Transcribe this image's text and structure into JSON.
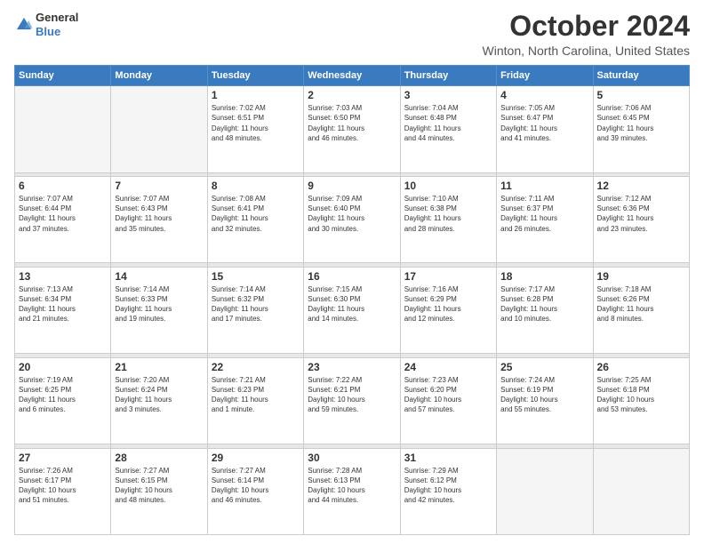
{
  "header": {
    "logo_general": "General",
    "logo_blue": "Blue",
    "title": "October 2024",
    "location": "Winton, North Carolina, United States"
  },
  "weekdays": [
    "Sunday",
    "Monday",
    "Tuesday",
    "Wednesday",
    "Thursday",
    "Friday",
    "Saturday"
  ],
  "weeks": [
    [
      {
        "num": "",
        "lines": []
      },
      {
        "num": "",
        "lines": []
      },
      {
        "num": "1",
        "lines": [
          "Sunrise: 7:02 AM",
          "Sunset: 6:51 PM",
          "Daylight: 11 hours",
          "and 48 minutes."
        ]
      },
      {
        "num": "2",
        "lines": [
          "Sunrise: 7:03 AM",
          "Sunset: 6:50 PM",
          "Daylight: 11 hours",
          "and 46 minutes."
        ]
      },
      {
        "num": "3",
        "lines": [
          "Sunrise: 7:04 AM",
          "Sunset: 6:48 PM",
          "Daylight: 11 hours",
          "and 44 minutes."
        ]
      },
      {
        "num": "4",
        "lines": [
          "Sunrise: 7:05 AM",
          "Sunset: 6:47 PM",
          "Daylight: 11 hours",
          "and 41 minutes."
        ]
      },
      {
        "num": "5",
        "lines": [
          "Sunrise: 7:06 AM",
          "Sunset: 6:45 PM",
          "Daylight: 11 hours",
          "and 39 minutes."
        ]
      }
    ],
    [
      {
        "num": "6",
        "lines": [
          "Sunrise: 7:07 AM",
          "Sunset: 6:44 PM",
          "Daylight: 11 hours",
          "and 37 minutes."
        ]
      },
      {
        "num": "7",
        "lines": [
          "Sunrise: 7:07 AM",
          "Sunset: 6:43 PM",
          "Daylight: 11 hours",
          "and 35 minutes."
        ]
      },
      {
        "num": "8",
        "lines": [
          "Sunrise: 7:08 AM",
          "Sunset: 6:41 PM",
          "Daylight: 11 hours",
          "and 32 minutes."
        ]
      },
      {
        "num": "9",
        "lines": [
          "Sunrise: 7:09 AM",
          "Sunset: 6:40 PM",
          "Daylight: 11 hours",
          "and 30 minutes."
        ]
      },
      {
        "num": "10",
        "lines": [
          "Sunrise: 7:10 AM",
          "Sunset: 6:38 PM",
          "Daylight: 11 hours",
          "and 28 minutes."
        ]
      },
      {
        "num": "11",
        "lines": [
          "Sunrise: 7:11 AM",
          "Sunset: 6:37 PM",
          "Daylight: 11 hours",
          "and 26 minutes."
        ]
      },
      {
        "num": "12",
        "lines": [
          "Sunrise: 7:12 AM",
          "Sunset: 6:36 PM",
          "Daylight: 11 hours",
          "and 23 minutes."
        ]
      }
    ],
    [
      {
        "num": "13",
        "lines": [
          "Sunrise: 7:13 AM",
          "Sunset: 6:34 PM",
          "Daylight: 11 hours",
          "and 21 minutes."
        ]
      },
      {
        "num": "14",
        "lines": [
          "Sunrise: 7:14 AM",
          "Sunset: 6:33 PM",
          "Daylight: 11 hours",
          "and 19 minutes."
        ]
      },
      {
        "num": "15",
        "lines": [
          "Sunrise: 7:14 AM",
          "Sunset: 6:32 PM",
          "Daylight: 11 hours",
          "and 17 minutes."
        ]
      },
      {
        "num": "16",
        "lines": [
          "Sunrise: 7:15 AM",
          "Sunset: 6:30 PM",
          "Daylight: 11 hours",
          "and 14 minutes."
        ]
      },
      {
        "num": "17",
        "lines": [
          "Sunrise: 7:16 AM",
          "Sunset: 6:29 PM",
          "Daylight: 11 hours",
          "and 12 minutes."
        ]
      },
      {
        "num": "18",
        "lines": [
          "Sunrise: 7:17 AM",
          "Sunset: 6:28 PM",
          "Daylight: 11 hours",
          "and 10 minutes."
        ]
      },
      {
        "num": "19",
        "lines": [
          "Sunrise: 7:18 AM",
          "Sunset: 6:26 PM",
          "Daylight: 11 hours",
          "and 8 minutes."
        ]
      }
    ],
    [
      {
        "num": "20",
        "lines": [
          "Sunrise: 7:19 AM",
          "Sunset: 6:25 PM",
          "Daylight: 11 hours",
          "and 6 minutes."
        ]
      },
      {
        "num": "21",
        "lines": [
          "Sunrise: 7:20 AM",
          "Sunset: 6:24 PM",
          "Daylight: 11 hours",
          "and 3 minutes."
        ]
      },
      {
        "num": "22",
        "lines": [
          "Sunrise: 7:21 AM",
          "Sunset: 6:23 PM",
          "Daylight: 11 hours",
          "and 1 minute."
        ]
      },
      {
        "num": "23",
        "lines": [
          "Sunrise: 7:22 AM",
          "Sunset: 6:21 PM",
          "Daylight: 10 hours",
          "and 59 minutes."
        ]
      },
      {
        "num": "24",
        "lines": [
          "Sunrise: 7:23 AM",
          "Sunset: 6:20 PM",
          "Daylight: 10 hours",
          "and 57 minutes."
        ]
      },
      {
        "num": "25",
        "lines": [
          "Sunrise: 7:24 AM",
          "Sunset: 6:19 PM",
          "Daylight: 10 hours",
          "and 55 minutes."
        ]
      },
      {
        "num": "26",
        "lines": [
          "Sunrise: 7:25 AM",
          "Sunset: 6:18 PM",
          "Daylight: 10 hours",
          "and 53 minutes."
        ]
      }
    ],
    [
      {
        "num": "27",
        "lines": [
          "Sunrise: 7:26 AM",
          "Sunset: 6:17 PM",
          "Daylight: 10 hours",
          "and 51 minutes."
        ]
      },
      {
        "num": "28",
        "lines": [
          "Sunrise: 7:27 AM",
          "Sunset: 6:15 PM",
          "Daylight: 10 hours",
          "and 48 minutes."
        ]
      },
      {
        "num": "29",
        "lines": [
          "Sunrise: 7:27 AM",
          "Sunset: 6:14 PM",
          "Daylight: 10 hours",
          "and 46 minutes."
        ]
      },
      {
        "num": "30",
        "lines": [
          "Sunrise: 7:28 AM",
          "Sunset: 6:13 PM",
          "Daylight: 10 hours",
          "and 44 minutes."
        ]
      },
      {
        "num": "31",
        "lines": [
          "Sunrise: 7:29 AM",
          "Sunset: 6:12 PM",
          "Daylight: 10 hours",
          "and 42 minutes."
        ]
      },
      {
        "num": "",
        "lines": []
      },
      {
        "num": "",
        "lines": []
      }
    ]
  ]
}
